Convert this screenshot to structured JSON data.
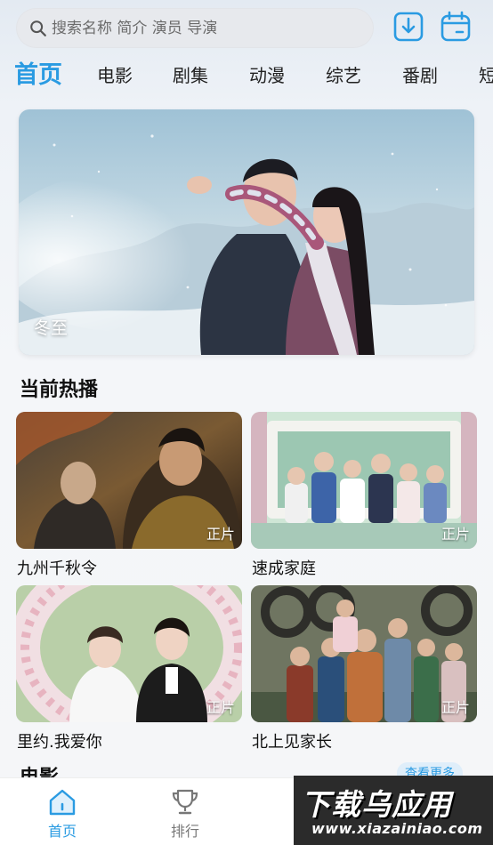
{
  "search": {
    "placeholder": "搜索名称 简介 演员 导演"
  },
  "header_icons": {
    "download": "download-icon",
    "calendar": "calendar-icon",
    "accent_color": "#2a9be2"
  },
  "tabs": [
    {
      "label": "首页",
      "active": true
    },
    {
      "label": "电影",
      "active": false
    },
    {
      "label": "剧集",
      "active": false
    },
    {
      "label": "动漫",
      "active": false
    },
    {
      "label": "综艺",
      "active": false
    },
    {
      "label": "番剧",
      "active": false
    },
    {
      "label": "短",
      "active": false
    }
  ],
  "banner": {
    "title": "冬至"
  },
  "hot_section": {
    "title": "当前热播",
    "items": [
      {
        "title": "九州千秋令",
        "badge": "正片"
      },
      {
        "title": "速成家庭",
        "badge": "正片"
      },
      {
        "title": "里约.我爱你",
        "badge": "正片"
      },
      {
        "title": "北上见家长",
        "badge": "正片"
      }
    ]
  },
  "movie_section": {
    "title": "电影",
    "more_label": "查看更多"
  },
  "bottom_nav": {
    "home_label": "首页",
    "rank_label": "排行"
  },
  "watermark": {
    "top": "下载乌应用",
    "bottom": "www.xiazainiao.com"
  }
}
